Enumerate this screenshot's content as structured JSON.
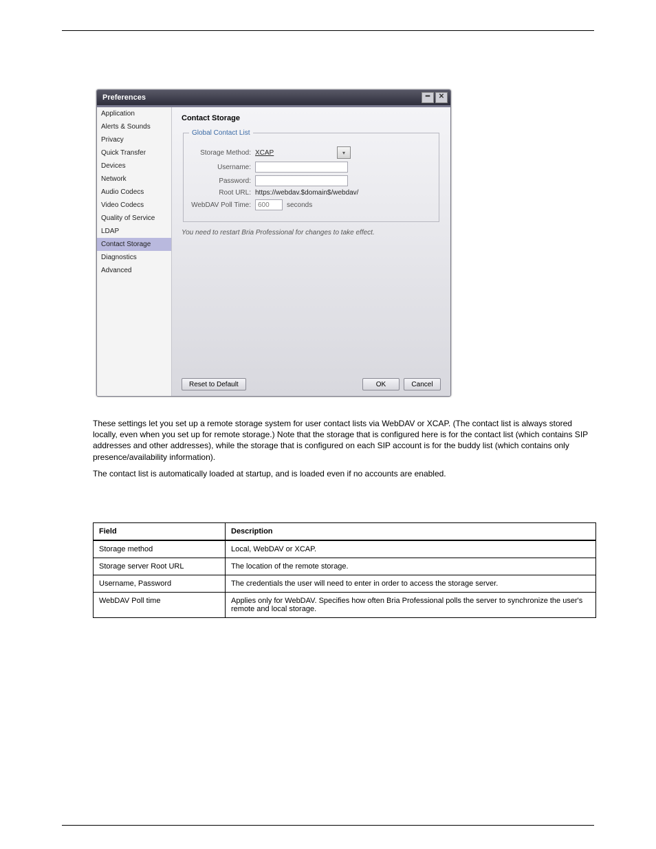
{
  "page_header": {
    "left": "",
    "right": ""
  },
  "page_footer": {
    "left": "",
    "right": ""
  },
  "window": {
    "title": "Preferences",
    "icons": {
      "min": "minimize-icon",
      "close": "close-icon"
    },
    "sidebar": {
      "items": [
        {
          "label": "Application"
        },
        {
          "label": "Alerts & Sounds"
        },
        {
          "label": "Privacy"
        },
        {
          "label": "Quick Transfer"
        },
        {
          "label": "Devices"
        },
        {
          "label": "Network"
        },
        {
          "label": "Audio Codecs"
        },
        {
          "label": "Video Codecs"
        },
        {
          "label": "Quality of Service"
        },
        {
          "label": "LDAP"
        },
        {
          "label": "Contact Storage",
          "selected": true
        },
        {
          "label": "Diagnostics"
        },
        {
          "label": "Advanced"
        }
      ]
    },
    "content": {
      "title": "Contact Storage",
      "fieldset_legend": "Global Contact List",
      "rows": {
        "storage_method": {
          "label": "Storage Method:",
          "value": "XCAP"
        },
        "username": {
          "label": "Username:",
          "value": ""
        },
        "password": {
          "label": "Password:",
          "value": ""
        },
        "root_url": {
          "label": "Root URL:",
          "value": "https://webdav.$domain$/webdav/"
        },
        "poll": {
          "label": "WebDAV Poll Time:",
          "value": "600",
          "unit": "seconds"
        }
      },
      "note": "You need to restart Bria Professional for changes to take effect."
    },
    "buttons": {
      "reset": "Reset to Default",
      "ok": "OK",
      "cancel": "Cancel"
    }
  },
  "bodytext": {
    "p1": "These settings let you set up a remote storage system for user contact lists via WebDAV or XCAP. (The contact list is always stored locally, even when you set up for remote storage.) Note that the storage that is configured here is for the contact list (which contains SIP addresses and other addresses), while the storage that is configured on each SIP account is for the buddy list (which contains only presence/availability information).",
    "p2": "The contact list is automatically loaded at startup, and is loaded even if no accounts are enabled."
  },
  "table": {
    "headers": {
      "field": "Field",
      "description": "Description"
    },
    "rows": [
      {
        "field": "Storage method",
        "description": "Local, WebDAV or XCAP."
      },
      {
        "field": "Storage server Root URL",
        "description": "The location of the remote storage."
      },
      {
        "field": "Username, Password",
        "description": "The credentials the user will need to enter in order to access the storage server."
      },
      {
        "field": "WebDAV Poll time",
        "description": "Applies only for WebDAV. Specifies how often Bria Professional polls the server to synchronize the user's remote and local storage."
      }
    ]
  }
}
